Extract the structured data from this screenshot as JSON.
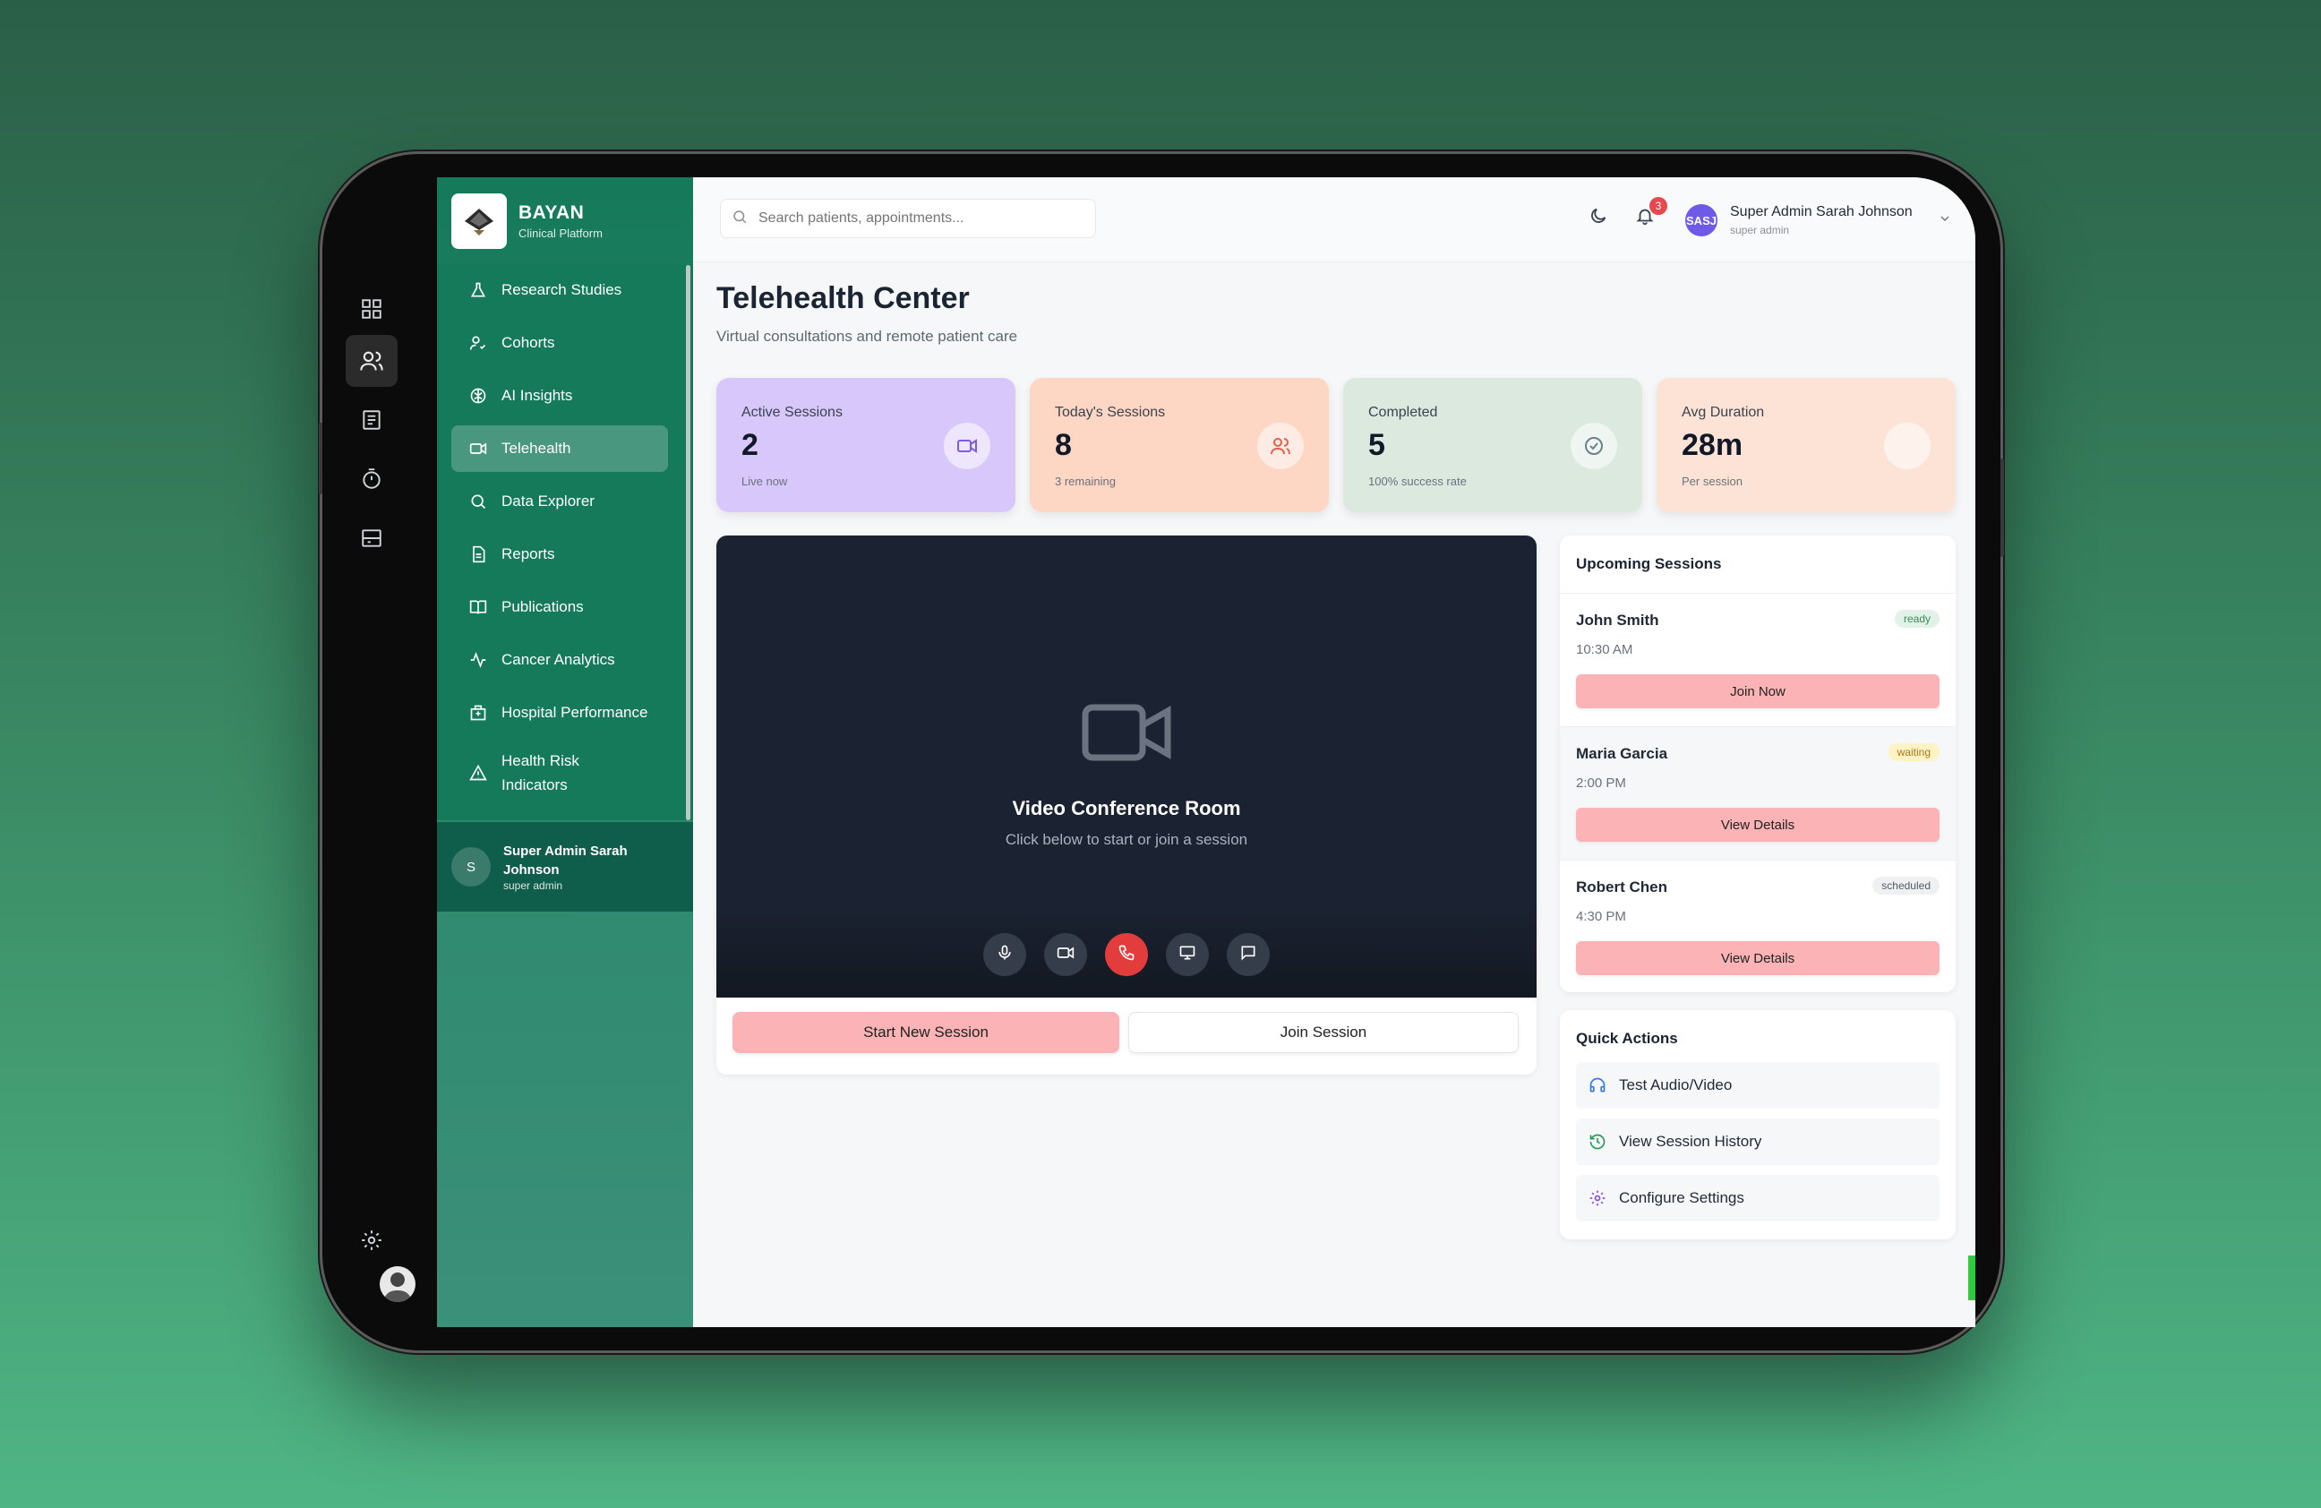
{
  "brand": {
    "name": "BAYAN",
    "subtitle": "Clinical Platform"
  },
  "rail": {
    "icons": [
      "grid-icon",
      "users-icon",
      "document-icon",
      "timer-icon",
      "inbox-icon",
      "settings-icon"
    ]
  },
  "menu": {
    "items": [
      {
        "label": "Research Studies",
        "icon": "flask-icon"
      },
      {
        "label": "Cohorts",
        "icon": "user-check-icon"
      },
      {
        "label": "AI Insights",
        "icon": "brain-icon"
      },
      {
        "label": "Telehealth",
        "icon": "video-icon",
        "active": true
      },
      {
        "label": "Data Explorer",
        "icon": "search-icon"
      },
      {
        "label": "Reports",
        "icon": "file-icon"
      },
      {
        "label": "Publications",
        "icon": "book-icon"
      },
      {
        "label": "Cancer Analytics",
        "icon": "activity-icon"
      },
      {
        "label": "Hospital Performance",
        "icon": "hospital-icon"
      },
      {
        "label": "Health Risk Indicators",
        "icon": "alert-icon"
      }
    ],
    "user": {
      "initial": "S",
      "name": "Super Admin Sarah Johnson",
      "role": "super admin"
    }
  },
  "header": {
    "search_placeholder": "Search patients, appointments...",
    "notification_count": "3",
    "avatar_initials": "SASJ",
    "user_name": "Super Admin Sarah Johnson",
    "user_role": "super admin"
  },
  "page": {
    "title": "Telehealth Center",
    "subtitle": "Virtual consultations and remote patient care"
  },
  "stats": [
    {
      "label": "Active Sessions",
      "value": "2",
      "note": "Live now",
      "bg": "#d8c7fb",
      "icon": "video-icon",
      "icon_color": "#7c5ce0"
    },
    {
      "label": "Today's Sessions",
      "value": "8",
      "note": "3 remaining",
      "bg": "#fdd6c4",
      "icon": "users-icon",
      "icon_color": "#e0604a"
    },
    {
      "label": "Completed",
      "value": "5",
      "note": "100% success rate",
      "bg": "#dbe9df",
      "icon": "check-circle-icon",
      "icon_color": "#6d7f8c"
    },
    {
      "label": "Avg Duration",
      "value": "28m",
      "note": "Per session",
      "bg": "#fde3d6",
      "icon": "clock-icon",
      "icon_color": "#f5c9b5"
    }
  ],
  "video": {
    "title": "Video Conference Room",
    "subtitle": "Click below to start or join a session",
    "start_label": "Start New Session",
    "join_label": "Join Session"
  },
  "upcoming": {
    "title": "Upcoming Sessions",
    "sessions": [
      {
        "name": "John Smith",
        "time": "10:30 AM",
        "status": "ready",
        "status_bg": "#e3f2e8",
        "status_color": "#3a8a5a",
        "action": "Join Now"
      },
      {
        "name": "Maria Garcia",
        "time": "2:00 PM",
        "status": "waiting",
        "status_bg": "#fdf3c4",
        "status_color": "#a5791b",
        "action": "View Details"
      },
      {
        "name": "Robert Chen",
        "time": "4:30 PM",
        "status": "scheduled",
        "status_bg": "#eef0f2",
        "status_color": "#555b63",
        "action": "View Details"
      }
    ]
  },
  "quick_actions": {
    "title": "Quick Actions",
    "items": [
      {
        "label": "Test Audio/Video",
        "icon": "headphones-icon",
        "color": "#2f7ae5"
      },
      {
        "label": "View Session History",
        "icon": "history-icon",
        "color": "#2a9a5a"
      },
      {
        "label": "Configure Settings",
        "icon": "gear-icon",
        "color": "#8a4fe0"
      }
    ]
  }
}
